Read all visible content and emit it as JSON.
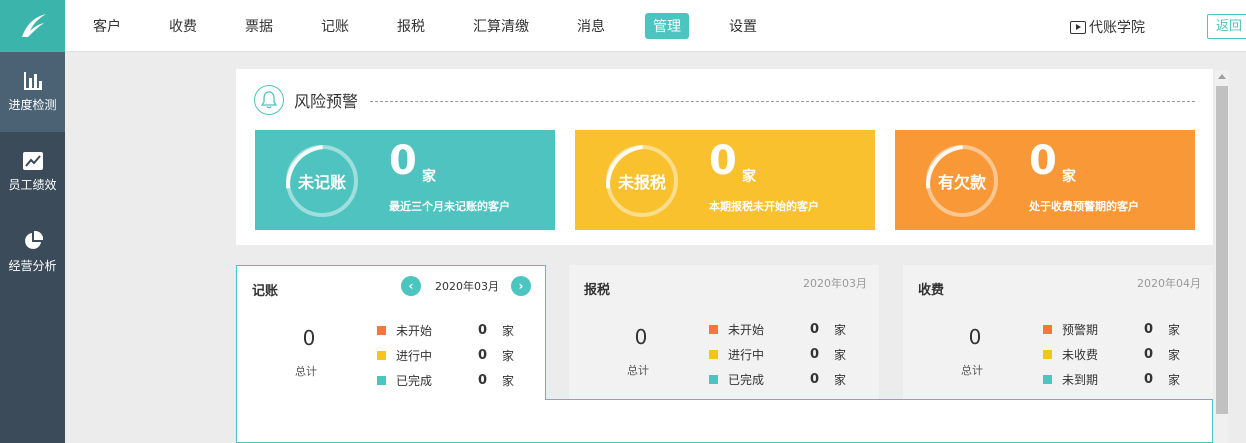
{
  "colors": {
    "teal": "#4fc3bf",
    "yellow": "#f9c12e",
    "orange": "#f89836",
    "sidebar": "#3c4b59",
    "sq_orange": "#f5773d",
    "sq_yellow": "#f5c518",
    "sq_teal": "#4cc4bf"
  },
  "nav": {
    "items": [
      "客户",
      "收费",
      "票据",
      "记账",
      "报税",
      "汇算清缴",
      "消息",
      "管理",
      "设置"
    ],
    "active_index": 7,
    "academy": "代账学院",
    "back": "返回"
  },
  "sidebar": {
    "items": [
      {
        "label": "进度检测",
        "icon": "bar-chart-icon"
      },
      {
        "label": "员工绩效",
        "icon": "trend-chart-icon"
      },
      {
        "label": "经营分析",
        "icon": "pie-chart-icon"
      }
    ]
  },
  "risk": {
    "title": "风险预警",
    "tiles": [
      {
        "ring": "未记账",
        "num": "0",
        "unit": "家",
        "desc": "最近三个月未记账的客户"
      },
      {
        "ring": "未报税",
        "num": "0",
        "unit": "家",
        "desc": "本期报税未开始的客户"
      },
      {
        "ring": "有欠款",
        "num": "0",
        "unit": "家",
        "desc": "处于收费预警期的客户"
      }
    ]
  },
  "panels": [
    {
      "title": "记账",
      "date": "2020年03月",
      "total": "0",
      "total_label": "总计",
      "legend": [
        {
          "label": "未开始",
          "value": "0",
          "unit": "家"
        },
        {
          "label": "进行中",
          "value": "0",
          "unit": "家"
        },
        {
          "label": "已完成",
          "value": "0",
          "unit": "家"
        }
      ]
    },
    {
      "title": "报税",
      "date": "2020年03月",
      "total": "0",
      "total_label": "总计",
      "legend": [
        {
          "label": "未开始",
          "value": "0",
          "unit": "家"
        },
        {
          "label": "进行中",
          "value": "0",
          "unit": "家"
        },
        {
          "label": "已完成",
          "value": "0",
          "unit": "家"
        }
      ]
    },
    {
      "title": "收费",
      "date": "2020年04月",
      "total": "0",
      "total_label": "总计",
      "legend": [
        {
          "label": "预警期",
          "value": "0",
          "unit": "家"
        },
        {
          "label": "未收费",
          "value": "0",
          "unit": "家"
        },
        {
          "label": "未到期",
          "value": "0",
          "unit": "家"
        }
      ]
    }
  ]
}
